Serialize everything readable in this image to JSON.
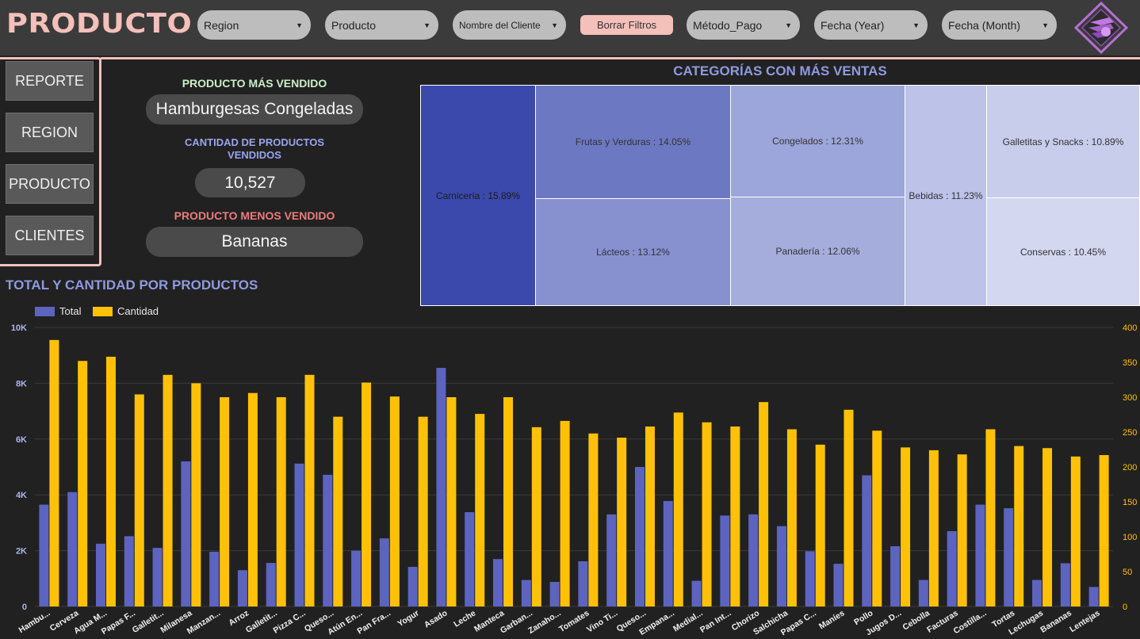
{
  "header": {
    "title": "PRODUCTO",
    "filters": [
      {
        "label": "Region"
      },
      {
        "label": "Producto"
      },
      {
        "label": "Nombre del Cliente"
      },
      {
        "label": "Método_Pago"
      },
      {
        "label": "Fecha (Year)"
      },
      {
        "label": "Fecha (Month)"
      }
    ],
    "clear_label": "Borrar Filtros",
    "accent_color": "#f4c0ba"
  },
  "nav": {
    "items": [
      {
        "label": "REPORTE"
      },
      {
        "label": "REGION"
      },
      {
        "label": "PRODUCTO"
      },
      {
        "label": "CLIENTES"
      }
    ]
  },
  "kpis": {
    "top_label": "PRODUCTO MÁS VENDIDO",
    "top_value": "Hamburgesas Congeladas",
    "qty_label_1": "CANTIDAD DE PRODUCTOS",
    "qty_label_2": "VENDIDOS",
    "qty_value": "10,527",
    "low_label": "PRODUCTO MENOS VENDIDO",
    "low_value": "Bananas",
    "colors": {
      "top": "#c8f0c8",
      "qty": "#9aa4ee",
      "low": "#f07a7a"
    }
  },
  "treemap": {
    "title": "CATEGORÍAS CON MÁS VENTAS",
    "cells": [
      {
        "label": "Carnicería : 15.89%",
        "share": 15.89,
        "color": "#3a49ab"
      },
      {
        "label": "Frutas y Verduras : 14.05%",
        "share": 14.05,
        "color": "#6d78c2"
      },
      {
        "label": "Lácteos : 13.12%",
        "share": 13.12,
        "color": "#8791d0"
      },
      {
        "label": "Congelados : 12.31%",
        "share": 12.31,
        "color": "#9da6da"
      },
      {
        "label": "Panadería : 12.06%",
        "share": 12.06,
        "color": "#a5addd"
      },
      {
        "label": "Bebidas : 11.23%",
        "share": 11.23,
        "color": "#bcc2e8"
      },
      {
        "label": "Galletitas y Snacks : 10.89%",
        "share": 10.89,
        "color": "#c8cdec"
      },
      {
        "label": "Conservas : 10.45%",
        "share": 10.45,
        "color": "#d3d7f0"
      }
    ]
  },
  "chart_title": "TOTAL Y CANTIDAD POR PRODUCTOS",
  "chart_data": {
    "type": "bar",
    "categories": [
      "Hambu...",
      "Cerveza",
      "Agua M...",
      "Papas F...",
      "Galletit...",
      "Milanesa",
      "Manzan...",
      "Arroz",
      "Galletit...",
      "Pizza C...",
      "Queso...",
      "Atún En...",
      "Pan Fra...",
      "Yogur",
      "Asado",
      "Leche",
      "Manteca",
      "Garban...",
      "Zanaho...",
      "Tomates",
      "Vino Ti...",
      "Queso...",
      "Empana...",
      "Medial...",
      "Pan Int...",
      "Chorizo",
      "Salchicha",
      "Papas C...",
      "Maníes",
      "Pollo",
      "Jugos D...",
      "Cebolla",
      "Facturas",
      "Costilla...",
      "Tortas",
      "Lechugas",
      "Bananas",
      "Lentejas"
    ],
    "series": [
      {
        "name": "Total",
        "axis": "left",
        "color": "#5c64c0",
        "values": [
          3650,
          4100,
          2250,
          2520,
          2100,
          5200,
          1960,
          1300,
          1560,
          5120,
          4720,
          2000,
          2440,
          1420,
          8550,
          3380,
          1700,
          950,
          880,
          1620,
          3300,
          5000,
          3780,
          920,
          3260,
          3300,
          2880,
          1980,
          1530,
          4700,
          2160,
          950,
          2700,
          3650,
          3520,
          950,
          1550,
          700
        ]
      },
      {
        "name": "Cantidad",
        "axis": "right",
        "color": "#ffc107",
        "values": [
          382,
          352,
          358,
          304,
          332,
          320,
          300,
          306,
          300,
          332,
          272,
          321,
          301,
          272,
          300,
          276,
          300,
          257,
          266,
          248,
          242,
          258,
          278,
          264,
          258,
          293,
          254,
          232,
          282,
          252,
          228,
          224,
          218,
          254,
          230,
          227,
          215,
          217
        ]
      }
    ],
    "y_left": {
      "min": 0,
      "max": 10000,
      "ticks": [
        0,
        2000,
        4000,
        6000,
        8000,
        10000
      ],
      "tick_labels": [
        "0",
        "2K",
        "4K",
        "6K",
        "8K",
        "10K"
      ]
    },
    "y_right": {
      "min": 0,
      "max": 400,
      "ticks": [
        0,
        50,
        100,
        150,
        200,
        250,
        300,
        350,
        400
      ]
    },
    "legend": "top-left",
    "grid": true
  }
}
